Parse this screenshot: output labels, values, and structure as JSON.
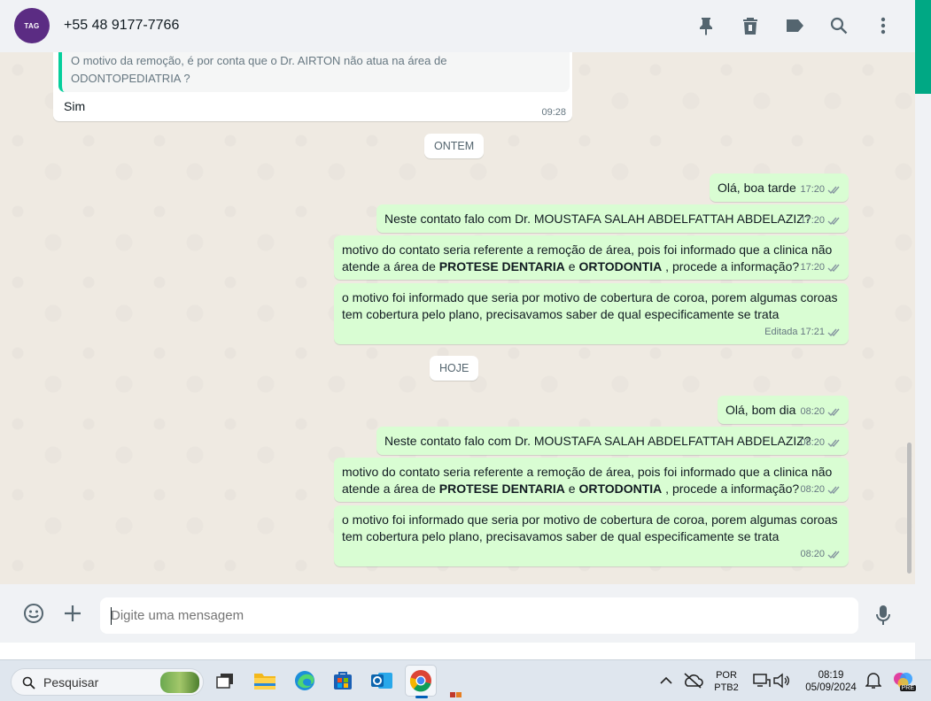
{
  "header": {
    "avatar_text": "TAG",
    "contact_name": "+55 48 9177-7766",
    "icons": [
      "pin-icon",
      "trash-icon",
      "label-icon",
      "search-icon",
      "more-vertical-icon"
    ]
  },
  "chat": {
    "quoted_message": {
      "quote_text": "O motivo da remoção, é por conta que o Dr. AIRTON não atua na área de ODONTOPEDIATRIA ?",
      "reply_text": "Sim",
      "time": "09:28"
    },
    "day_chips": [
      "ONTEM",
      "HOJE"
    ],
    "yesterday": [
      {
        "text": "Olá, boa tarde",
        "time": "17:20"
      },
      {
        "text": "Neste contato falo com Dr. MOUSTAFA SALAH ABDELFATTAH ABDELAZIZ?",
        "time": "17:20"
      },
      {
        "text_a": "motivo do contato seria referente a remoção de área, pois foi informado que a clinica não atende a área de ",
        "bold1": "PROTESE DENTARIA",
        "mid": " e ",
        "bold2": "ORTODONTIA",
        "text_b": " , procede a informação?",
        "time": "17:20"
      },
      {
        "text": "o motivo foi informado que seria por motivo de cobertura de coroa, porem algumas coroas tem cobertura pelo plano, precisavamos saber de qual especificamente se trata",
        "edited": "Editada",
        "time": "17:21"
      }
    ],
    "today": [
      {
        "text": "Olá, bom dia",
        "time": "08:20"
      },
      {
        "text": "Neste contato falo com Dr. MOUSTAFA SALAH ABDELFATTAH ABDELAZIZ?",
        "time": "08:20"
      },
      {
        "text_a": "motivo do contato seria referente a remoção de área, pois foi informado que a clinica não atende a área de ",
        "bold1": "PROTESE DENTARIA",
        "mid": " e ",
        "bold2": "ORTODONTIA",
        "text_b": " , procede a informação?",
        "time": "08:20"
      },
      {
        "text": "o motivo foi informado que seria por motivo de cobertura de coroa, porem algumas coroas tem cobertura pelo plano, precisavamos saber de qual especificamente se trata",
        "time": "08:20"
      }
    ]
  },
  "compose": {
    "placeholder": "Digite uma mensagem",
    "icons": [
      "emoji-icon",
      "plus-icon",
      "microphone-icon"
    ]
  },
  "taskbar": {
    "search_label": "Pesquisar",
    "lang_line1": "POR",
    "lang_line2": "PTB2",
    "clock_time": "08:19",
    "clock_date": "05/09/2024",
    "copilot_badge": "PRE"
  },
  "colors": {
    "accent": "#00a884",
    "outgoing_bubble": "#d9fdd3",
    "incoming_bubble": "#ffffff",
    "chat_bg": "#efeae2",
    "tick_blue": "#53bdeb"
  }
}
